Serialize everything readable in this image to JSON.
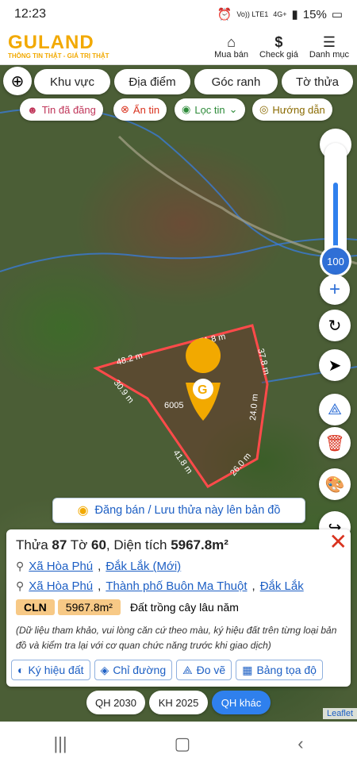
{
  "status": {
    "time": "12:23",
    "net": "Vo)) LTE1",
    "net2": "4G+",
    "battery": "15%"
  },
  "header": {
    "brand": "GULAND",
    "slogan": "THÔNG TIN THẬT - GIÁ TRỊ THẬT",
    "nav": [
      {
        "label": "Mua bán",
        "icon": "house-icon"
      },
      {
        "label": "Check giá",
        "icon": "dollar-icon"
      },
      {
        "label": "Danh mục",
        "icon": "menu-icon"
      }
    ]
  },
  "filters": [
    "Khu vực",
    "Địa điểm",
    "Góc ranh",
    "Tờ thửa"
  ],
  "chips": [
    {
      "label": "Tin đã đăng",
      "color": "#c0365a"
    },
    {
      "label": "Ẩn tin",
      "color": "#d9331f"
    },
    {
      "label": "Lọc tin",
      "color": "#2e8b3a"
    },
    {
      "label": "Hướng dẫn",
      "color": "#8a6a00"
    }
  ],
  "zoom": {
    "value": "100",
    "level": 0.8
  },
  "plot": {
    "area_label": "6005",
    "edges": [
      "51.8 m",
      "48.2 m",
      "37.8 m",
      "30.9 m",
      "24.0 m",
      "41.8 m",
      "26.0 m"
    ]
  },
  "post_button": "Đăng bán / Lưu thửa này lên bản đồ",
  "panel": {
    "title_prefix": "Thửa ",
    "parcel": "87",
    "sheet_prefix": " Tờ ",
    "sheet": "60",
    "area_prefix": ", Diện tích ",
    "area": "5967.8m²",
    "loc1": {
      "commune": "Xã Hòa Phú",
      "province": "Đắk Lắk (Mới)"
    },
    "loc2": {
      "commune": "Xã Hòa Phú",
      "city": "Thành phố Buôn Ma Thuột",
      "province": "Đắk Lắk"
    },
    "land_code": "CLN",
    "land_area": "5967.8m²",
    "land_type": "Đất trồng cây lâu năm",
    "note": "(Dữ liệu tham khảo, vui lòng căn cứ theo màu, ký hiệu đất trên từng loại bản đồ và kiểm tra lại với cơ quan chức năng trước khi giao dịch)",
    "actions": [
      "Ký hiệu đất",
      "Chỉ đường",
      "Đo vẽ",
      "Bảng tọa độ"
    ]
  },
  "qh": [
    "QH 2030",
    "KH 2025",
    "QH khác"
  ],
  "attribution": "Leaflet"
}
